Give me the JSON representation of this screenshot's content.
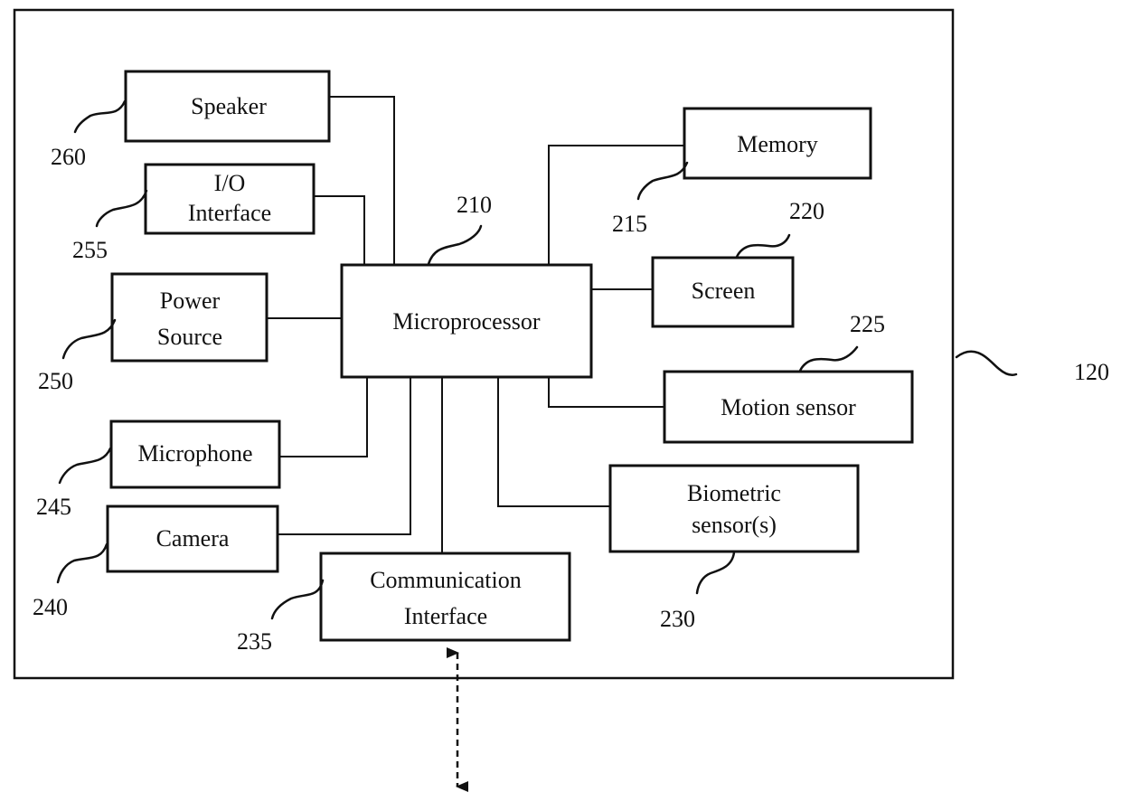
{
  "diagram": {
    "device_ref": "120",
    "blocks": {
      "microprocessor": {
        "label": "Microprocessor",
        "ref": "210"
      },
      "memory": {
        "label": "Memory",
        "ref": "215"
      },
      "screen": {
        "label": "Screen",
        "ref": "220"
      },
      "motion_sensor": {
        "label": "Motion sensor",
        "ref": "225"
      },
      "biometric": {
        "line1": "Biometric",
        "line2": "sensor(s)",
        "ref": "230"
      },
      "communication": {
        "line1": "Communication",
        "line2": "Interface",
        "ref": "235"
      },
      "camera": {
        "label": "Camera",
        "ref": "240"
      },
      "microphone": {
        "label": "Microphone",
        "ref": "245"
      },
      "power": {
        "line1": "Power",
        "line2": "Source",
        "ref": "250"
      },
      "io": {
        "line1": "I/O",
        "line2": "Interface",
        "ref": "255"
      },
      "speaker": {
        "label": "Speaker",
        "ref": "260"
      }
    },
    "external_link": "bidirectional-dashed-arrow"
  }
}
